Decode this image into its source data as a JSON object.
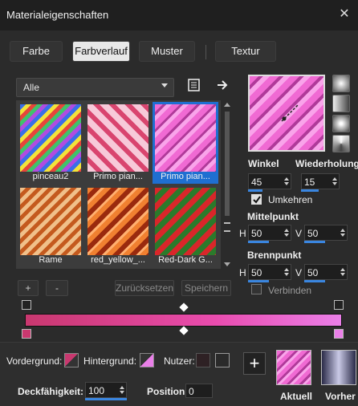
{
  "window": {
    "title": "Materialeigenschaften",
    "close_glyph": "✕"
  },
  "tabs": [
    {
      "label": "Farbe",
      "active": false
    },
    {
      "label": "Farbverlauf",
      "active": true
    },
    {
      "label": "Muster",
      "active": false
    },
    {
      "label": "Textur",
      "active": false
    }
  ],
  "category": {
    "selected": "Alle"
  },
  "gallery": {
    "items": [
      {
        "label": "pinceau2",
        "selected": false
      },
      {
        "label": "Primo pian...",
        "selected": false
      },
      {
        "label": "Primo pian...",
        "selected": true
      },
      {
        "label": "Rame",
        "selected": false
      },
      {
        "label": "red_yellow_...",
        "selected": false
      },
      {
        "label": "Red-Dark G...",
        "selected": false
      }
    ]
  },
  "gallery_buttons": {
    "add": "+",
    "remove": "-",
    "reset": "Zurücksetzen",
    "save": "Speichern"
  },
  "settings": {
    "angle_label": "Winkel",
    "angle_value": "45",
    "repeat_label": "Wiederholung",
    "repeat_value": "15",
    "invert_label": "Umkehren",
    "invert_checked": true,
    "center_label": "Mittelpunkt",
    "center_h_label": "H",
    "center_h": "50",
    "center_v_label": "V",
    "center_v": "50",
    "focus_label": "Brennpunkt",
    "focus_h_label": "H",
    "focus_h": "50",
    "focus_v_label": "V",
    "focus_v": "50",
    "link_label": "Verbinden",
    "link_checked": false
  },
  "gradient": {
    "start_color": "#c9386f",
    "end_color": "#ea7fe8"
  },
  "footer": {
    "foreground_label": "Vordergrund:",
    "background_label": "Hintergrund:",
    "user_label": "Nutzer:",
    "opacity_label": "Deckfähigkeit:",
    "opacity_value": "100",
    "position_label": "Position:",
    "position_value": "0",
    "add_button": "+",
    "current_label": "Aktuell",
    "previous_label": "Vorher"
  }
}
